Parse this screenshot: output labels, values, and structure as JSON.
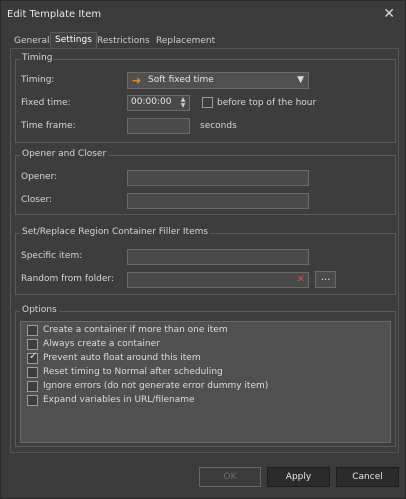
{
  "window": {
    "title": "Edit Template Item"
  },
  "tabs": [
    "General",
    "Settings",
    "Restrictions",
    "Replacement"
  ],
  "timing": {
    "group_label": "Timing",
    "timing_label": "Timing:",
    "timing_value": "Soft fixed time",
    "fixed_time_label": "Fixed time:",
    "fixed_time_value": "00:00:00",
    "before_top_label": "before top of the hour",
    "before_top_checked": false,
    "time_frame_label": "Time frame:",
    "time_frame_value": "",
    "seconds_label": "seconds"
  },
  "opener_closer": {
    "group_label": "Opener and Closer",
    "opener_label": "Opener:",
    "opener_value": "",
    "closer_label": "Closer:",
    "closer_value": ""
  },
  "filler": {
    "group_label": "Set/Replace Region Container Filler Items",
    "specific_label": "Specific item:",
    "specific_value": "",
    "random_label": "Random from folder:",
    "random_value": "",
    "browse_label": "..."
  },
  "options": {
    "group_label": "Options",
    "items": [
      {
        "label": "Create a container if more than one item",
        "checked": false
      },
      {
        "label": "Always create a container",
        "checked": false
      },
      {
        "label": "Prevent auto float around this item",
        "checked": true
      },
      {
        "label": "Reset timing to Normal after scheduling",
        "checked": false
      },
      {
        "label": "Ignore errors (do not generate error dummy item)",
        "checked": false
      },
      {
        "label": "Expand variables in URL/filename",
        "checked": false
      }
    ]
  },
  "buttons": {
    "ok": "OK",
    "apply": "Apply",
    "cancel": "Cancel"
  },
  "icons": {
    "close": "close-icon",
    "timing_arrow": "arrow-right-icon",
    "dropdown": "chevron-down-icon",
    "clear": "clear-x-icon"
  },
  "colors": {
    "accent_arrow": "#e8891e",
    "clear_x": "#d84a4a"
  }
}
